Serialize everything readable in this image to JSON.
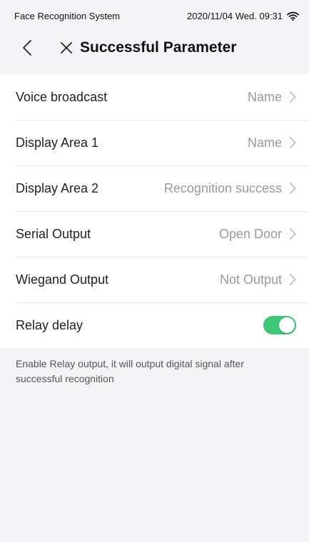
{
  "status_bar": {
    "app_name": "Face Recognition System",
    "datetime": "2020/11/04  Wed.  09:31"
  },
  "nav": {
    "title": "Successful Parameter"
  },
  "settings": {
    "rows": [
      {
        "label": "Voice broadcast",
        "value": "Name"
      },
      {
        "label": "Display Area 1",
        "value": "Name"
      },
      {
        "label": "Display Area 2",
        "value": "Recognition success"
      },
      {
        "label": "Serial Output",
        "value": "Open Door"
      },
      {
        "label": "Wiegand Output",
        "value": "Not Output"
      }
    ],
    "relay": {
      "label": "Relay delay",
      "enabled": true
    }
  },
  "note": "Enable Relay output, it will output digital signal after successful recognition",
  "colors": {
    "toggle_on": "#3ec877",
    "value_text": "#9a9a9e"
  }
}
